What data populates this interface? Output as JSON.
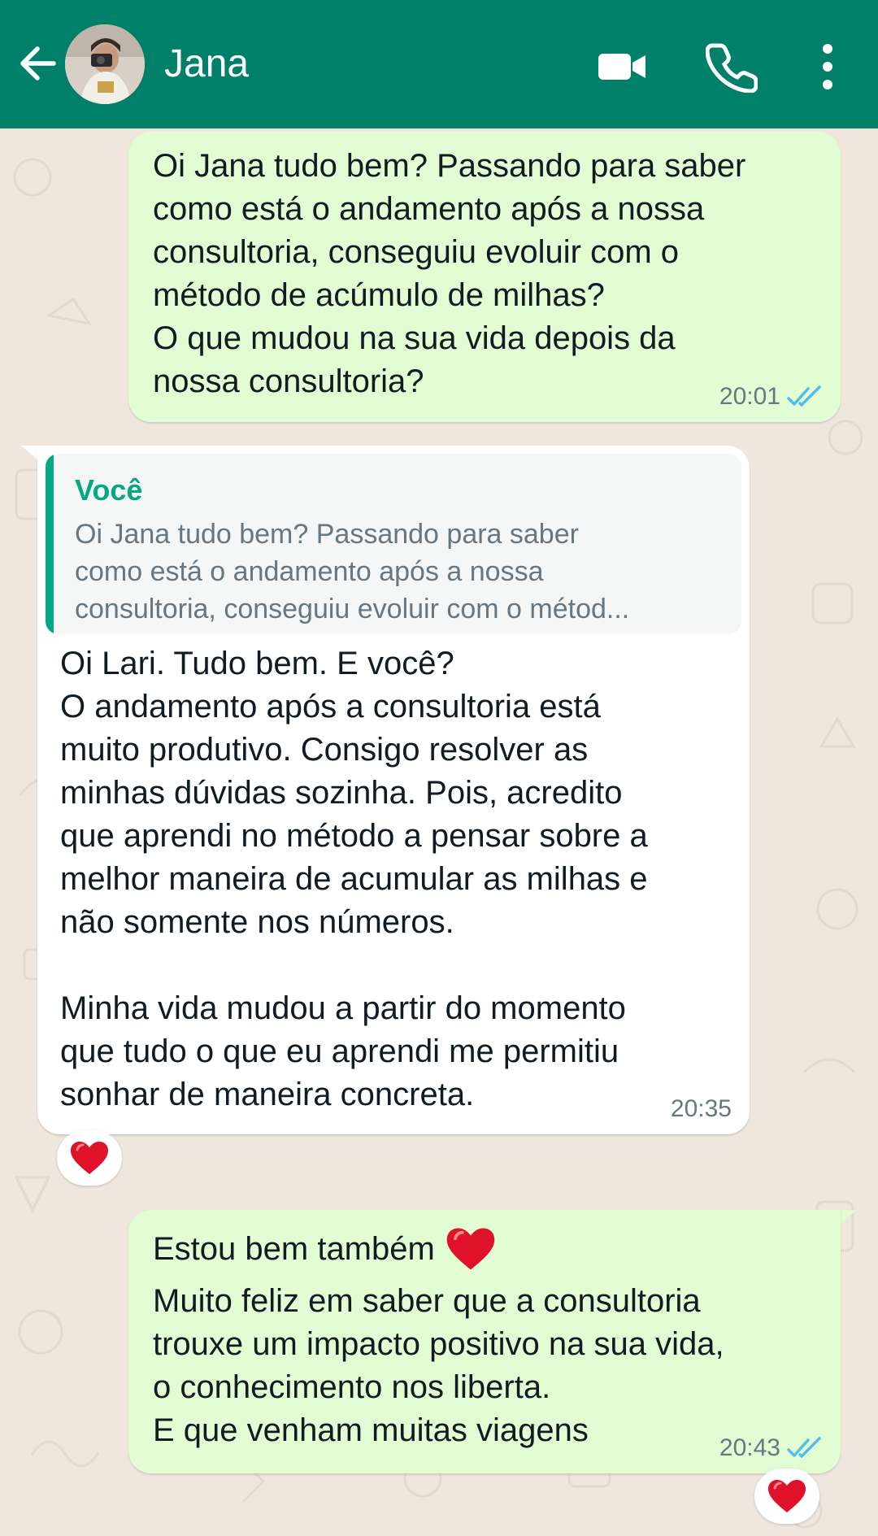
{
  "header": {
    "contact_name": "Jana",
    "bg_color": "#008069",
    "icons": [
      "back-arrow-icon",
      "video-call-icon",
      "phone-call-icon",
      "more-options-icon"
    ]
  },
  "messages": [
    {
      "direction": "outgoing",
      "text": "Oi Jana tudo bem? Passando para saber\ncomo está o andamento após a nossa\nconsultoria, conseguiu evoluir com o\nmétodo de acúmulo de milhas?\nO que mudou na sua vida depois da\nnossa consultoria?",
      "time": "20:01",
      "status": "read"
    },
    {
      "direction": "incoming",
      "quote": {
        "author": "Você",
        "text": "Oi Jana tudo bem? Passando para saber\ncomo está o andamento após a nossa\nconsultoria, conseguiu evoluir com o métod..."
      },
      "text": "Oi Lari. Tudo bem. E você?\nO andamento após a consultoria está\nmuito produtivo. Consigo resolver as\nminhas dúvidas sozinha. Pois, acredito\nque aprendi no método a pensar sobre a\nmelhor maneira de acumular as milhas e\nnão somente nos números.\n\nMinha vida mudou a partir do momento\nque tudo o que eu aprendi me permitiu\nsonhar de maneira concreta.",
      "time": "20:35",
      "reaction": "heart-emoji"
    },
    {
      "direction": "outgoing",
      "first_line": "Estou bem também",
      "text": "Muito feliz em saber que a consultoria\ntrouxe um impacto positivo na sua vida,\no conhecimento nos liberta.\nE que venham muitas viagens",
      "time": "20:43",
      "status": "read",
      "reaction": "heart-emoji"
    }
  ],
  "colors": {
    "outgoing_bubble": "#e2fdd3",
    "incoming_bubble": "#ffffff",
    "read_ticks": "#53bdeb",
    "quote_accent": "#06a884",
    "chat_background": "#efe7de"
  }
}
